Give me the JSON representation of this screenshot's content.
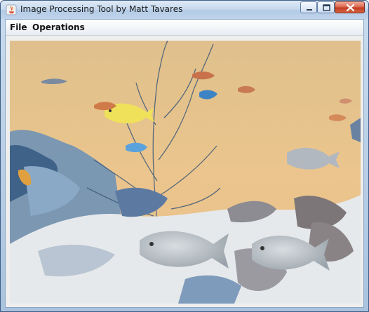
{
  "window": {
    "title": "Image Processing Tool by Matt Tavares",
    "controls": {
      "minimize": "minimize-icon",
      "maximize": "maximize-icon",
      "close": "close-icon"
    }
  },
  "menubar": {
    "items": [
      {
        "label": "File"
      },
      {
        "label": "Operations"
      }
    ]
  },
  "image": {
    "content": "color-inverted aquarium photo with fish and coral",
    "colors": {
      "background": "#e7c48c",
      "coral_blue": "#5b7fa6",
      "coral_light": "#e9ecef",
      "fish_gray": "#b9c0c6",
      "fish_yellow": "#efe25a"
    }
  }
}
